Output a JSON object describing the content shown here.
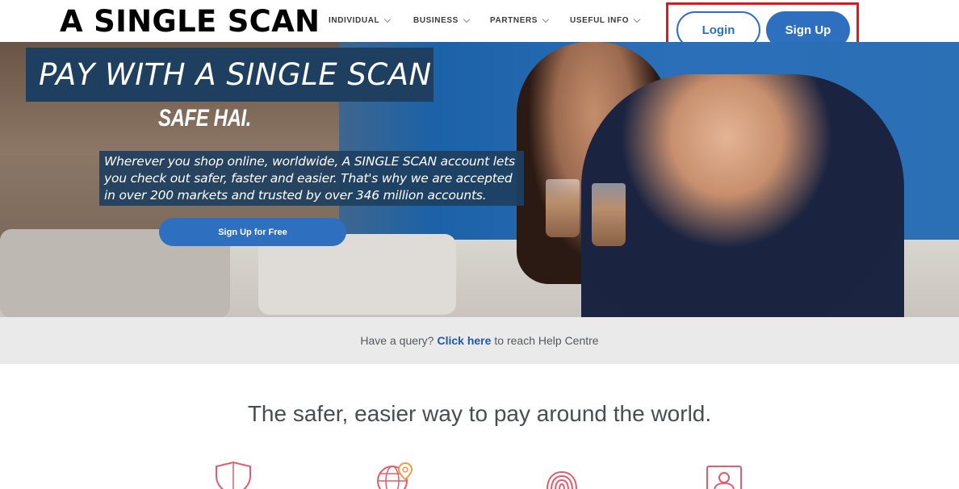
{
  "brand": {
    "name": "A SINGLE SCAN"
  },
  "nav": {
    "items": [
      {
        "label": "INDIVIDUAL"
      },
      {
        "label": "BUSINESS"
      },
      {
        "label": "PARTNERS"
      },
      {
        "label": "USEFUL INFO"
      }
    ]
  },
  "auth": {
    "login_label": "Login",
    "signup_label": "Sign Up"
  },
  "hero": {
    "title": "PAY WITH A SINGLE SCAN",
    "tagline": "SAFE HAI.",
    "description": "Wherever you shop online, worldwide, A SINGLE SCAN account lets you check out safer, faster and easier. That's why we are accepted in over 200 markets and trusted by over 346 million accounts.",
    "cta_label": "Sign Up for Free"
  },
  "help": {
    "prefix": "Have a query?",
    "link_label": "Click here",
    "suffix": "to reach Help Centre"
  },
  "features": {
    "heading": "The safer, easier way to pay around the world.",
    "icons": [
      "shield-icon",
      "globe-pin-icon",
      "fingerprint-icon",
      "id-card-icon"
    ]
  },
  "colors": {
    "primary": "#2f6fbf",
    "highlight_border": "#e8141b",
    "icon_accent": "#e45a6e"
  }
}
